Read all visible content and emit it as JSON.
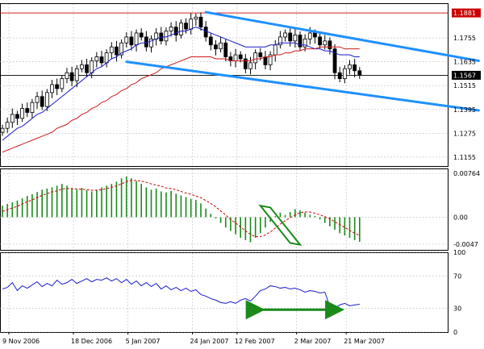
{
  "chart_data": [
    {
      "type": "line",
      "panel": "price",
      "subtype": "candlestick",
      "title": "",
      "xlabel": "",
      "ylabel": "",
      "ylim": [
        1.111,
        1.193
      ],
      "y_ticks": [
        "1.1881",
        "1.1755",
        "1.1635",
        "1.1567",
        "1.1515",
        "1.1395",
        "1.1275",
        "1.1155"
      ],
      "marked_levels": [
        {
          "label": "1.1881",
          "value": 1.1881,
          "color": "#cc0000"
        },
        {
          "label": "1.1567",
          "value": 1.1567,
          "color": "#000000"
        }
      ],
      "x_labels": [
        "9 Nov 2006",
        "18 Dec 2006",
        "5 Jan 2007",
        "24 Jan 2007",
        "12 Feb 2007",
        "2 Mar 2007",
        "21 Mar 2007"
      ],
      "close": [
        1.13,
        1.133,
        1.137,
        1.135,
        1.14,
        1.138,
        1.143,
        1.146,
        1.141,
        1.148,
        1.152,
        1.15,
        1.155,
        1.158,
        1.154,
        1.16,
        1.162,
        1.158,
        1.164,
        1.166,
        1.163,
        1.168,
        1.171,
        1.167,
        1.173,
        1.176,
        1.172,
        1.178,
        1.176,
        1.171,
        1.175,
        1.178,
        1.174,
        1.179,
        1.181,
        1.177,
        1.183,
        1.18,
        1.185,
        1.186,
        1.181,
        1.176,
        1.172,
        1.17,
        1.173,
        1.166,
        1.164,
        1.167,
        1.165,
        1.16,
        1.163,
        1.168,
        1.166,
        1.162,
        1.167,
        1.172,
        1.176,
        1.178,
        1.174,
        1.177,
        1.171,
        1.175,
        1.178,
        1.176,
        1.172,
        1.174,
        1.17,
        1.158,
        1.155,
        1.16,
        1.162,
        1.159,
        1.1567
      ],
      "series": [
        {
          "name": "",
          "color": "#1a1acc",
          "values": [
            1.124,
            1.126,
            1.128,
            1.13,
            1.131,
            1.133,
            1.135,
            1.137,
            1.138,
            1.14,
            1.142,
            1.144,
            1.146,
            1.148,
            1.15,
            1.152,
            1.154,
            1.156,
            1.158,
            1.16,
            1.161,
            1.163,
            1.165,
            1.166,
            1.168,
            1.169,
            1.17,
            1.172,
            1.173,
            1.173,
            1.174,
            1.175,
            1.176,
            1.176,
            1.177,
            1.178,
            1.179,
            1.179,
            1.18,
            1.181,
            1.18,
            1.179,
            1.178,
            1.177,
            1.176,
            1.175,
            1.174,
            1.173,
            1.172,
            1.171,
            1.171,
            1.171,
            1.171,
            1.171,
            1.172,
            1.172,
            1.173,
            1.173,
            1.173,
            1.173,
            1.172,
            1.172,
            1.171,
            1.17,
            1.17,
            1.169,
            1.169,
            1.168,
            1.167,
            1.167,
            1.167,
            1.166,
            1.166
          ]
        },
        {
          "name": "",
          "color": "#cc1a1a",
          "values": [
            1.118,
            1.119,
            1.12,
            1.121,
            1.122,
            1.123,
            1.124,
            1.125,
            1.126,
            1.127,
            1.128,
            1.13,
            1.131,
            1.132,
            1.134,
            1.135,
            1.137,
            1.138,
            1.14,
            1.141,
            1.143,
            1.144,
            1.146,
            1.147,
            1.149,
            1.15,
            1.152,
            1.153,
            1.155,
            1.156,
            1.157,
            1.158,
            1.16,
            1.161,
            1.162,
            1.163,
            1.164,
            1.165,
            1.166,
            1.166,
            1.166,
            1.166,
            1.166,
            1.165,
            1.165,
            1.165,
            1.164,
            1.164,
            1.164,
            1.164,
            1.164,
            1.165,
            1.165,
            1.166,
            1.166,
            1.167,
            1.167,
            1.168,
            1.168,
            1.169,
            1.169,
            1.17,
            1.17,
            1.17,
            1.171,
            1.171,
            1.171,
            1.171,
            1.171,
            1.17,
            1.17,
            1.17,
            1.17
          ]
        }
      ],
      "trendlines": [
        {
          "color": "#1e90ff",
          "from": [
            41,
            1.1885
          ],
          "to": [
            96,
            1.164
          ]
        },
        {
          "color": "#1e90ff",
          "from": [
            25,
            1.1635
          ],
          "to": [
            96,
            1.139
          ]
        }
      ]
    },
    {
      "type": "bar",
      "panel": "macd",
      "title": "",
      "ylim": [
        -0.0057,
        0.0085
      ],
      "y_ticks": [
        "0.00764",
        "0.00",
        "-0.0047"
      ],
      "histogram_color": "#1a8a1a",
      "signal_color": "#cc0000",
      "histogram": [
        0.002,
        0.0023,
        0.0026,
        0.0029,
        0.0033,
        0.0037,
        0.004,
        0.0044,
        0.0048,
        0.005,
        0.0052,
        0.0055,
        0.0058,
        0.0055,
        0.005,
        0.0048,
        0.0051,
        0.0047,
        0.0045,
        0.0048,
        0.0052,
        0.0055,
        0.0058,
        0.0062,
        0.0068,
        0.0071,
        0.0068,
        0.0063,
        0.0058,
        0.0052,
        0.0048,
        0.005,
        0.0045,
        0.0043,
        0.0046,
        0.0041,
        0.0038,
        0.0035,
        0.0032,
        0.003,
        0.0024,
        0.0015,
        0.0006,
        -0.0002,
        -0.001,
        -0.0018,
        -0.0024,
        -0.003,
        -0.0036,
        -0.004,
        -0.0044,
        -0.0036,
        -0.0028,
        -0.0018,
        -0.0008,
        0.0002,
        0.0008,
        0.0004,
        0.0009,
        0.0014,
        0.0012,
        0.0008,
        0.0004,
        0.0002,
        -0.0004,
        -0.001,
        -0.0016,
        -0.0022,
        -0.0028,
        -0.0032,
        -0.0036,
        -0.004,
        -0.0043
      ],
      "signal": [
        0.001,
        0.0013,
        0.0016,
        0.0019,
        0.0023,
        0.0027,
        0.003,
        0.0034,
        0.0038,
        0.0041,
        0.0044,
        0.0046,
        0.0049,
        0.005,
        0.005,
        0.0049,
        0.0049,
        0.0048,
        0.0047,
        0.0047,
        0.0048,
        0.005,
        0.0052,
        0.0055,
        0.0058,
        0.0062,
        0.0064,
        0.0064,
        0.0063,
        0.0061,
        0.0058,
        0.0056,
        0.0054,
        0.0051,
        0.005,
        0.0048,
        0.0045,
        0.0042,
        0.004,
        0.0037,
        0.0034,
        0.0029,
        0.0024,
        0.0018,
        0.0011,
        0.0004,
        -0.0004,
        -0.001,
        -0.0017,
        -0.0024,
        -0.003,
        -0.0034,
        -0.0034,
        -0.0031,
        -0.0026,
        -0.0019,
        -0.0012,
        -0.0006,
        -0.0001,
        0.0004,
        0.0008,
        0.0009,
        0.0009,
        0.0007,
        0.0004,
        0.0001,
        -0.0003,
        -0.0008,
        -0.0013,
        -0.0018,
        -0.0023,
        -0.0028,
        -0.0032
      ],
      "highlight_box": {
        "color": "#1a8a1a",
        "corners": [
          [
            52,
            0.002
          ],
          [
            54,
            0.0017
          ],
          [
            60,
            -0.0048
          ],
          [
            58,
            -0.0045
          ]
        ]
      }
    },
    {
      "type": "line",
      "panel": "oscillator",
      "title": "",
      "ylim": [
        0,
        100
      ],
      "y_ticks": [
        "100",
        "70",
        "30",
        "0"
      ],
      "line_color": "#1a1acc",
      "values": [
        54,
        56,
        62,
        52,
        58,
        55,
        59,
        63,
        57,
        61,
        58,
        65,
        60,
        62,
        66,
        61,
        64,
        67,
        63,
        66,
        65,
        68,
        64,
        67,
        62,
        66,
        60,
        64,
        58,
        62,
        57,
        61,
        54,
        58,
        53,
        56,
        52,
        55,
        51,
        53,
        47,
        45,
        42,
        40,
        37,
        36,
        38,
        36,
        40,
        42,
        39,
        45,
        52,
        54,
        58,
        57,
        55,
        56,
        54,
        55,
        53,
        50,
        52,
        51,
        49,
        50,
        32,
        30,
        34,
        36,
        33,
        34,
        35
      ],
      "arrow": {
        "color": "#1a8a1a",
        "from": [
          51,
          28
        ],
        "to": [
          67,
          28
        ]
      }
    }
  ]
}
